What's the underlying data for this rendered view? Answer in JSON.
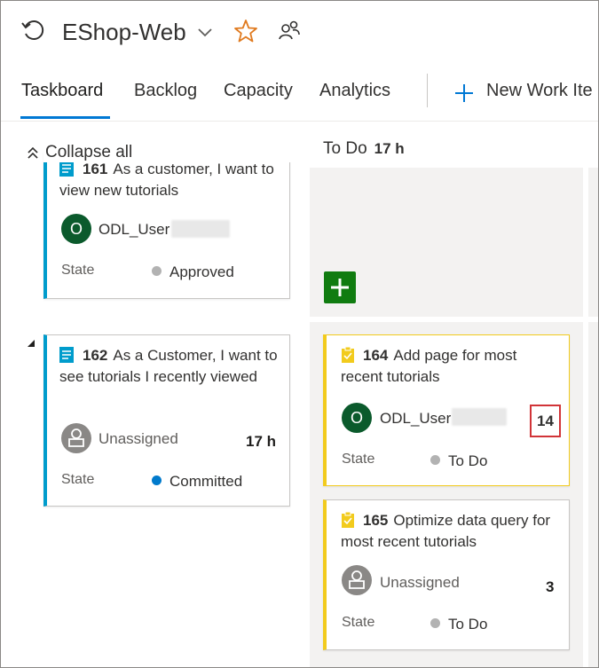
{
  "header": {
    "project_name": "EShop-Web"
  },
  "tabs": [
    {
      "label": "Taskboard",
      "active": true
    },
    {
      "label": "Backlog"
    },
    {
      "label": "Capacity"
    },
    {
      "label": "Analytics"
    }
  ],
  "toolbar": {
    "new_work_item_label": "New Work Ite"
  },
  "board": {
    "collapse_all_label": "Collapse all",
    "column": {
      "name": "To Do",
      "hours": "17 h"
    }
  },
  "stories": [
    {
      "id": "161",
      "title": "As a customer, I want to view new tutorials",
      "assignee": "ODL_User",
      "avatar_initial": "O",
      "state_label": "State",
      "state": "Approved",
      "state_color": "#b2b2b2"
    },
    {
      "id": "162",
      "title": "As a Customer, I want to see tutorials I recently viewed",
      "assignee": "Unassigned",
      "hours": "17 h",
      "state_label": "State",
      "state": "Committed",
      "state_color": "#007acc"
    }
  ],
  "tasks": [
    {
      "id": "164",
      "title": "Add page for most recent tutorials",
      "assignee": "ODL_User",
      "avatar_initial": "O",
      "remaining": "14",
      "state_label": "State",
      "state": "To Do",
      "state_color": "#b2b2b2"
    },
    {
      "id": "165",
      "title": "Optimize data query for most recent tutorials",
      "assignee": "Unassigned",
      "remaining": "3",
      "state_label": "State",
      "state": "To Do",
      "state_color": "#b2b2b2"
    }
  ],
  "colors": {
    "accent": "#0078d4",
    "story_bar": "#009ccc",
    "task_bar": "#f2cb1d",
    "add_button": "#107c10",
    "highlight_box": "#d13438",
    "avatar": "#0b5a2c"
  }
}
